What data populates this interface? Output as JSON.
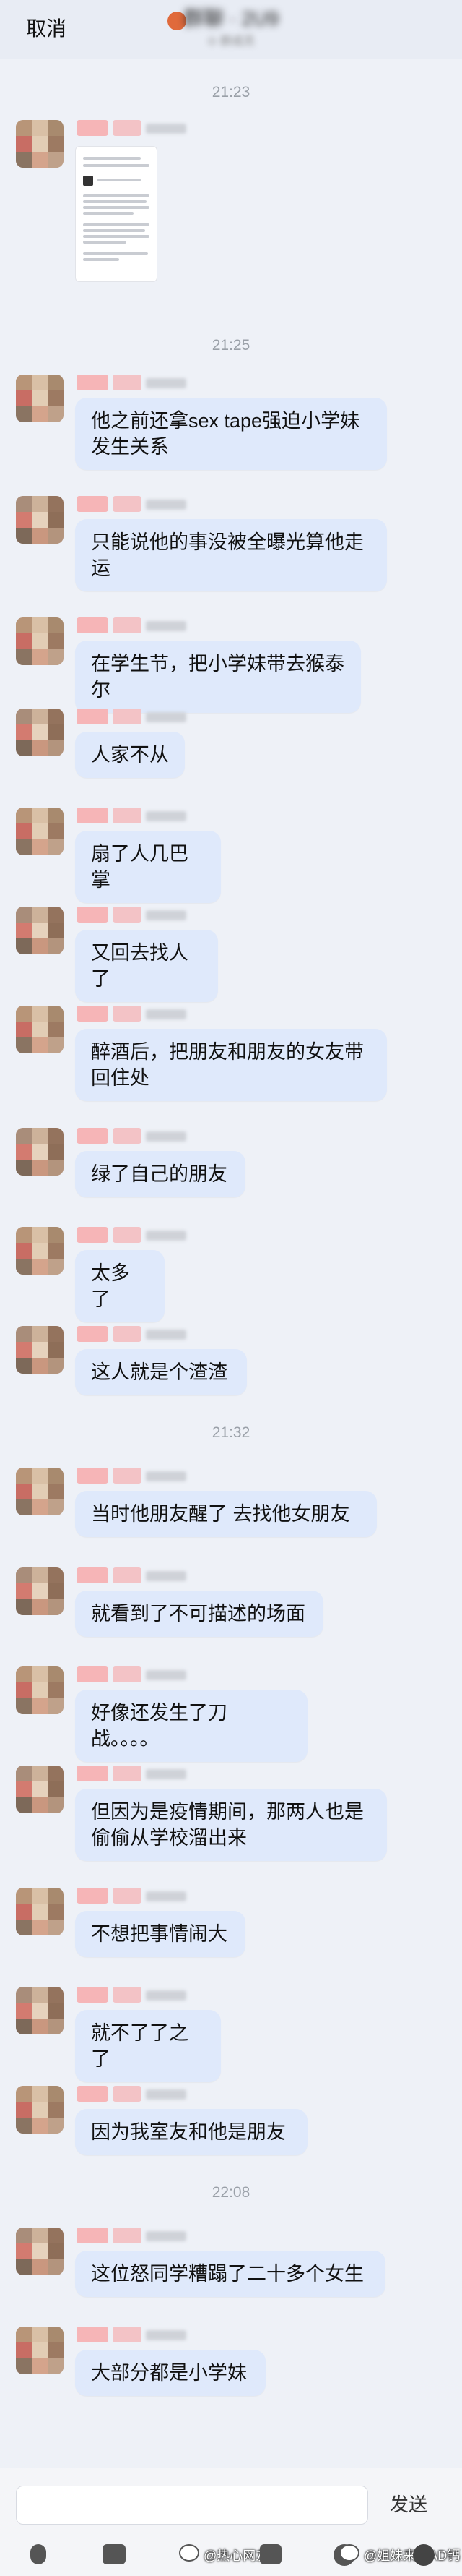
{
  "header": {
    "cancel_label": "取消",
    "title": "群聊 · 2U9",
    "subtitle": "⊙ 群成员"
  },
  "timestamps": [
    "21:23",
    "21:25",
    "21:32",
    "22:08"
  ],
  "messages": [
    "他之前还拿sex tape强迫小学妹发生关系",
    "只能说他的事没被全曝光算他走运",
    "在学生节，把小学妹带去猴泰尔",
    "人家不从",
    "扇了人几巴掌",
    "又回去找人了",
    "醉酒后，把朋友和朋友的女友带回住处",
    "绿了自己的朋友",
    "太多了",
    "这人就是个渣渣",
    "当时他朋友醒了 去找他女朋友",
    "就看到了不可描述的场面",
    "好像还发生了刀战。。。。",
    "但因为是疫情期间，那两人也是偷偷从学校溜出来",
    "不想把事情闹大",
    "就不了了之了",
    "因为我室友和他是朋友",
    "这位怒同学糟蹋了二十多个女生",
    "大部分都是小学妹"
  ],
  "input": {
    "value": "",
    "send_label": "发送"
  },
  "watermarks": {
    "left": "@热心网友",
    "right": "@姐妹来搞AD钙"
  },
  "colors": {
    "background": "#eef1f7",
    "bubble": "#dfe9fb",
    "badge": "#f6b5b7",
    "timestamp": "#9aa0a8"
  }
}
